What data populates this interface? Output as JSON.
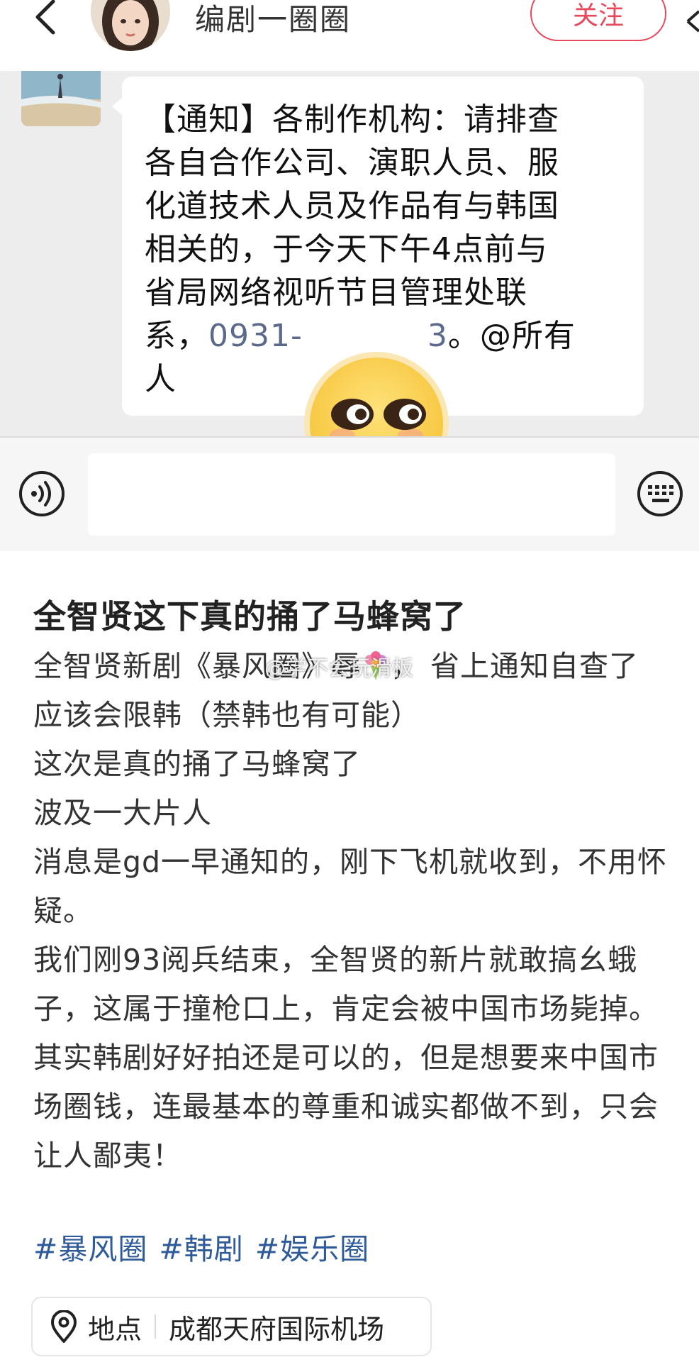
{
  "header": {
    "author_name": "编剧一圈圈",
    "follow_label": "关注"
  },
  "chat": {
    "notice_lines": [
      "【通知】各制作机构：请排查",
      "各自合作公司、演职人员、服",
      "化道技术人员及作品有与韩国",
      "相关的，于今天下午4点前与",
      "省局网络视听节目管理处联"
    ],
    "notice_last_prefix": "系，",
    "notice_phone": "0931-",
    "notice_phone_tail": "3",
    "notice_last_suffix": "。@所有",
    "notice_end": "人"
  },
  "post": {
    "title": "全智贤这下真的捅了马蜂窝了",
    "lines": [
      "全智贤新剧《暴风圈》辱",
      "应该会限韩（禁韩也有可能）",
      "这次是真的捅了马蜂窝了",
      "波及一大片人",
      "消息是gd一早通知的，刚下飞机就收到，不用怀",
      "疑。",
      "我们刚93阅兵结束，全智贤的新片就敢搞幺蛾",
      "子，这属于撞枪口上，肯定会被中国市场毙掉。",
      "其实韩剧好好拍还是可以的，但是想要来中国市",
      "场圈钱，连最基本的尊重和诚实都做不到，只会",
      "让人鄙夷！"
    ],
    "line1_suffix": "，  省上通知自查了",
    "watermark": "@学不会玩滑板",
    "tags": [
      "#暴风圈",
      "#韩剧",
      "#娱乐圈"
    ],
    "location_label": "地点",
    "location_value": "成都天府国际机场"
  },
  "colors": {
    "accent_red": "#e8485b",
    "tag_blue": "#2f5b9a",
    "chat_bg": "#ededed"
  },
  "icons": [
    "back-arrow-icon",
    "share-icon",
    "voice-icon",
    "keyboard-icon",
    "smile-emoji-sticker",
    "flower-bouquet-icon",
    "location-pin-icon"
  ]
}
